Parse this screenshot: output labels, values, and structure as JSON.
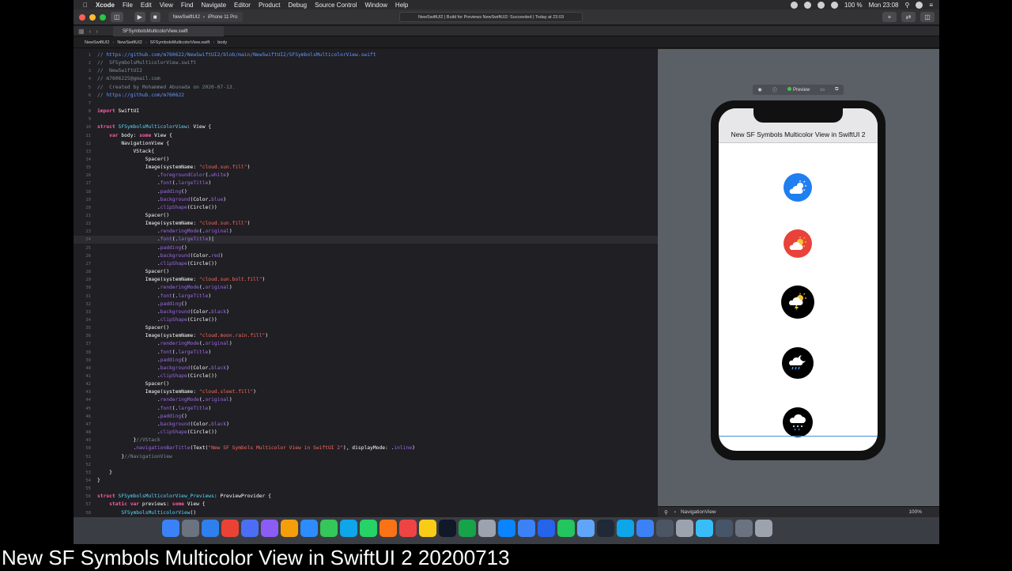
{
  "menubar": {
    "app": "Xcode",
    "items": [
      "File",
      "Edit",
      "View",
      "Find",
      "Navigate",
      "Editor",
      "Product",
      "Debug",
      "Source Control",
      "Window",
      "Help"
    ],
    "battery": "100 %",
    "clock": "Mon 23:08"
  },
  "toolbar": {
    "scheme": "NewSwiftUI2",
    "device": "iPhone 11 Pro",
    "status": "NewSwiftUI2 | Build for Previews NewSwiftUI2: Succeeded | Today at 23:03"
  },
  "tab": {
    "label": "SFSymbolsMulticolorView.swift"
  },
  "jumpbar": [
    "NewSwiftUI2",
    "NewSwiftUI2",
    "SFSymbolsMulticolorView.swift",
    "body"
  ],
  "editor": {
    "lines": [
      {
        "n": "1",
        "t": "// https://github.com/m760622/NewSwiftUI2/blob/main/NewSwiftUI2/SFSymbolsMulticolorView.swift",
        "c": "link"
      },
      {
        "n": "2",
        "t": "//  SFSymbolsMulticolorView.swift",
        "c": "comment"
      },
      {
        "n": "3",
        "t": "//  NewSwiftUI2",
        "c": "comment"
      },
      {
        "n": "4",
        "t": "// m7606225@gmail.com",
        "c": "comment"
      },
      {
        "n": "5",
        "t": "//  Created by Mohammed Abunada on 2020-07-13.",
        "c": "comment"
      },
      {
        "n": "6",
        "t": "// https://github.com/m760622",
        "c": "link"
      },
      {
        "n": "7",
        "t": "",
        "c": "plain"
      },
      {
        "n": "8",
        "t": "import SwiftUI",
        "c": "plain"
      },
      {
        "n": "9",
        "t": "",
        "c": "plain"
      },
      {
        "n": "10",
        "t": "struct SFSymbolsMulticolorView: View {",
        "c": "plain"
      },
      {
        "n": "11",
        "t": "    var body: some View {",
        "c": "plain"
      },
      {
        "n": "12",
        "t": "        NavigationView {",
        "c": "plain"
      },
      {
        "n": "13",
        "t": "            VStack{",
        "c": "plain"
      },
      {
        "n": "14",
        "t": "                Spacer()",
        "c": "plain"
      },
      {
        "n": "15",
        "t": "                Image(systemName: \"cloud.sun.fill\")",
        "c": "plain"
      },
      {
        "n": "16",
        "t": "                    .foregroundColor(.white)",
        "c": "plain"
      },
      {
        "n": "17",
        "t": "                    .font(.largeTitle)",
        "c": "plain"
      },
      {
        "n": "18",
        "t": "                    .padding()",
        "c": "plain"
      },
      {
        "n": "19",
        "t": "                    .background(Color.blue)",
        "c": "plain"
      },
      {
        "n": "20",
        "t": "                    .clipShape(Circle())",
        "c": "plain"
      },
      {
        "n": "21",
        "t": "                Spacer()",
        "c": "plain"
      },
      {
        "n": "22",
        "t": "                Image(systemName: \"cloud.sun.fill\")",
        "c": "plain"
      },
      {
        "n": "23",
        "t": "                    .renderingMode(.original)",
        "c": "plain"
      },
      {
        "n": "24",
        "t": "                    .font(.largeTitle)|",
        "c": "plain"
      },
      {
        "n": "25",
        "t": "                    .padding()",
        "c": "plain"
      },
      {
        "n": "26",
        "t": "                    .background(Color.red)",
        "c": "plain"
      },
      {
        "n": "27",
        "t": "                    .clipShape(Circle())",
        "c": "plain"
      },
      {
        "n": "28",
        "t": "                Spacer()",
        "c": "plain"
      },
      {
        "n": "29",
        "t": "                Image(systemName: \"cloud.sun.bolt.fill\")",
        "c": "plain"
      },
      {
        "n": "30",
        "t": "                    .renderingMode(.original)",
        "c": "plain"
      },
      {
        "n": "31",
        "t": "                    .font(.largeTitle)",
        "c": "plain"
      },
      {
        "n": "32",
        "t": "                    .padding()",
        "c": "plain"
      },
      {
        "n": "33",
        "t": "                    .background(Color.black)",
        "c": "plain"
      },
      {
        "n": "34",
        "t": "                    .clipShape(Circle())",
        "c": "plain"
      },
      {
        "n": "35",
        "t": "                Spacer()",
        "c": "plain"
      },
      {
        "n": "36",
        "t": "                Image(systemName: \"cloud.moon.rain.fill\")",
        "c": "plain"
      },
      {
        "n": "37",
        "t": "                    .renderingMode(.original)",
        "c": "plain"
      },
      {
        "n": "38",
        "t": "                    .font(.largeTitle)",
        "c": "plain"
      },
      {
        "n": "39",
        "t": "                    .padding()",
        "c": "plain"
      },
      {
        "n": "40",
        "t": "                    .background(Color.black)",
        "c": "plain"
      },
      {
        "n": "41",
        "t": "                    .clipShape(Circle())",
        "c": "plain"
      },
      {
        "n": "42",
        "t": "                Spacer()",
        "c": "plain"
      },
      {
        "n": "43",
        "t": "                Image(systemName: \"cloud.sleet.fill\")",
        "c": "plain"
      },
      {
        "n": "44",
        "t": "                    .renderingMode(.original)",
        "c": "plain"
      },
      {
        "n": "45",
        "t": "                    .font(.largeTitle)",
        "c": "plain"
      },
      {
        "n": "46",
        "t": "                    .padding()",
        "c": "plain"
      },
      {
        "n": "47",
        "t": "                    .background(Color.black)",
        "c": "plain"
      },
      {
        "n": "48",
        "t": "                    .clipShape(Circle())",
        "c": "plain"
      },
      {
        "n": "49",
        "t": "            }//VStack",
        "c": "plain"
      },
      {
        "n": "50",
        "t": "            .navigationBarTitle(Text(\"New SF Symbols Multicolor View in SwiftUI 2\"), displayMode: .inline)",
        "c": "plain"
      },
      {
        "n": "51",
        "t": "        }//NavigationView",
        "c": "plain"
      },
      {
        "n": "52",
        "t": "",
        "c": "plain"
      },
      {
        "n": "53",
        "t": "    }",
        "c": "plain"
      },
      {
        "n": "54",
        "t": "}",
        "c": "plain"
      },
      {
        "n": "55",
        "t": "",
        "c": "plain"
      },
      {
        "n": "56",
        "t": "struct SFSymbolsMulticolorView_Previews: PreviewProvider {",
        "c": "plain"
      },
      {
        "n": "57",
        "t": "    static var previews: some View {",
        "c": "plain"
      },
      {
        "n": "58",
        "t": "        SFSymbolsMulticolorView()",
        "c": "plain"
      }
    ]
  },
  "canvas": {
    "preview_label": "Preview",
    "nav_title": "New SF Symbols Multicolor View in SwiftUI 2",
    "symbols": [
      {
        "name": "cloud.sun.fill",
        "bg": "#1f7ff0"
      },
      {
        "name": "cloud.sun.fill",
        "bg": "#e8423a"
      },
      {
        "name": "cloud.sun.bolt.fill",
        "bg": "#000000"
      },
      {
        "name": "cloud.moon.rain.fill",
        "bg": "#000000"
      },
      {
        "name": "cloud.sleet.fill",
        "bg": "#000000"
      }
    ],
    "breadcrumb": "NavigationView",
    "zoom": "100%"
  },
  "caption": "New SF Symbols Multicolor View in SwiftUI 2 20200713",
  "colors": {
    "keyword": "#fc5fa3",
    "string": "#fc6a5d",
    "comment": "#7f8c98",
    "link": "#6699ff",
    "type": "#d0a8ff",
    "method": "#a167e6",
    "number": "#d0bf69"
  }
}
